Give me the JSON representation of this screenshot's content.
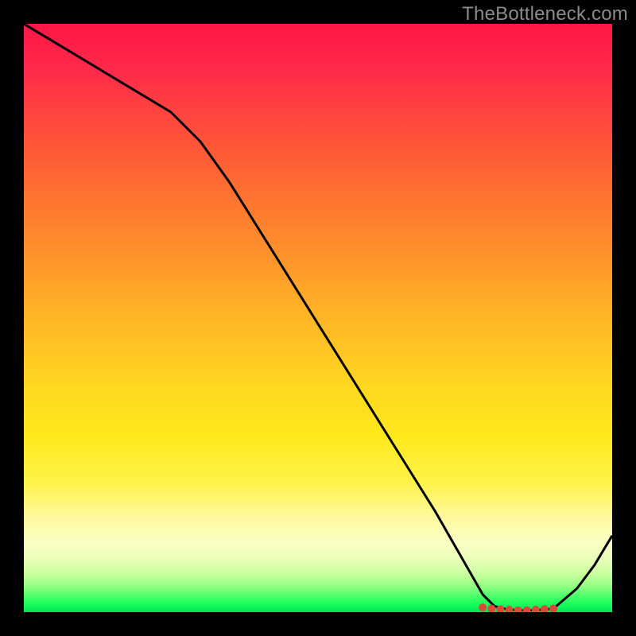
{
  "attribution": "TheBottleneck.com",
  "colors": {
    "line": "#000000",
    "dot": "#d94a3a"
  },
  "chart_data": {
    "type": "line",
    "title": "",
    "xlabel": "",
    "ylabel": "",
    "xlim": [
      0,
      100
    ],
    "ylim": [
      0,
      100
    ],
    "grid": false,
    "x": [
      0,
      5,
      10,
      15,
      20,
      25,
      30,
      35,
      40,
      45,
      50,
      55,
      60,
      65,
      70,
      74,
      78,
      80,
      82,
      84,
      86,
      88,
      90,
      94,
      97,
      100
    ],
    "values": [
      100,
      97,
      94,
      91,
      88,
      85,
      80,
      73,
      65,
      57,
      49,
      41,
      33,
      25,
      17,
      10,
      3,
      1,
      0.5,
      0.3,
      0.3,
      0.4,
      0.6,
      4,
      8,
      13
    ],
    "dots_x": [
      78,
      79.5,
      81,
      82.5,
      84,
      85.5,
      87,
      88.5,
      90
    ],
    "dots_y": [
      0.8,
      0.6,
      0.5,
      0.4,
      0.3,
      0.3,
      0.4,
      0.5,
      0.6
    ]
  }
}
